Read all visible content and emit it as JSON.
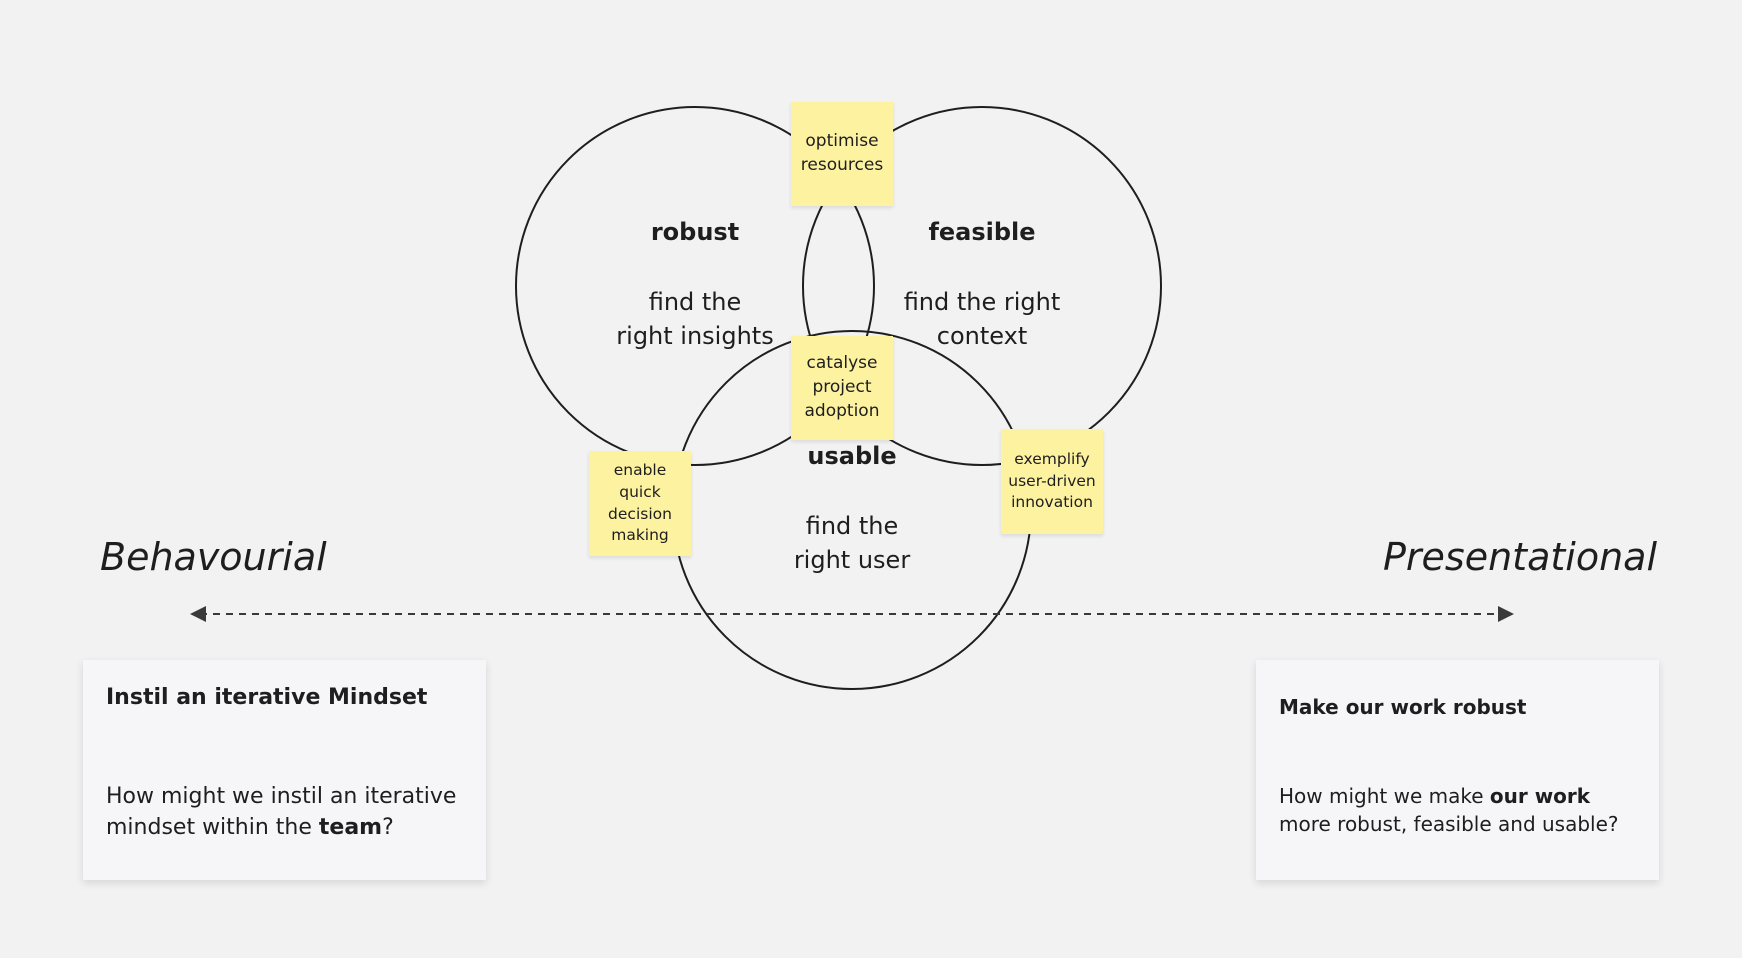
{
  "diagram": {
    "circles": [
      {
        "id": "robust",
        "title": "robust",
        "subtitle_line1": "find the",
        "subtitle_line2": "right insights"
      },
      {
        "id": "feasible",
        "title": "feasible",
        "subtitle_line1": "find the right",
        "subtitle_line2": "context"
      },
      {
        "id": "usable",
        "title": "usable",
        "subtitle_line1": "find the",
        "subtitle_line2": "right user"
      }
    ],
    "stickies": {
      "optimise": [
        "optimise",
        "resources"
      ],
      "catalyse": [
        "catalyse",
        "project",
        "adoption"
      ],
      "enable": [
        "enable",
        "quick",
        "decision",
        "making"
      ],
      "exemplify": [
        "exemplify",
        "user-driven",
        "innovation"
      ]
    },
    "sticky_color": "#fdf2a0",
    "line_color": "#1e1e1e"
  },
  "axis": {
    "left_label": "Behavourial",
    "right_label": "Presentational"
  },
  "cards": {
    "left": {
      "title": "Instil an iterative Mindset",
      "body_line1": "How might we instil an iterative",
      "body_line2_prefix": "mindset within the ",
      "body_line2_bold": "team",
      "body_line2_suffix": "?"
    },
    "right": {
      "title": "Make our work robust",
      "body_line1_prefix": "How might we make ",
      "body_line1_bold": "our work",
      "body_line2": "more robust, feasible and usable?"
    }
  }
}
